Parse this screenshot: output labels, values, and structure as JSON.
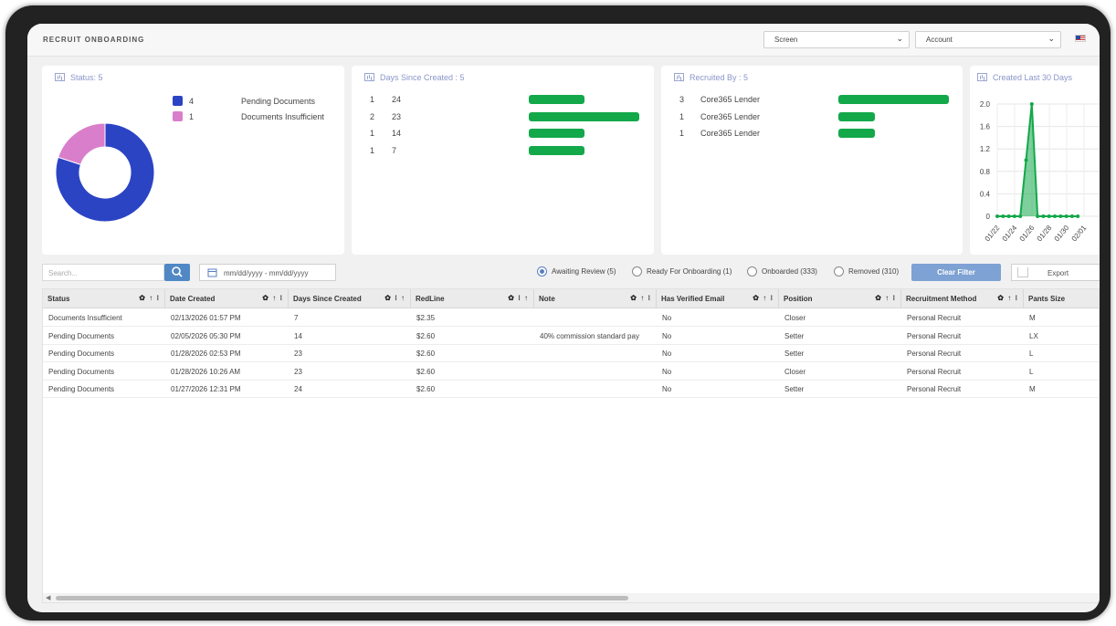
{
  "header": {
    "title": "RECRUIT ONBOARDING",
    "screen_select": "Screen",
    "account_select": "Account"
  },
  "status_card": {
    "title": "Status: 5",
    "legend": [
      {
        "count": "4",
        "label": "Pending Documents",
        "color": "#2b44c4"
      },
      {
        "count": "1",
        "label": "Documents Insufficient",
        "color": "#d97ecb"
      }
    ],
    "donut_values": [
      4,
      1
    ]
  },
  "days_card": {
    "title": "Days Since Created : 5",
    "rows": [
      {
        "count": "1",
        "label": "24",
        "value": 1
      },
      {
        "count": "2",
        "label": "23",
        "value": 2
      },
      {
        "count": "1",
        "label": "14",
        "value": 1
      },
      {
        "count": "1",
        "label": "7",
        "value": 1
      }
    ]
  },
  "recruited_card": {
    "title": "Recruited By : 5",
    "rows": [
      {
        "count": "3",
        "label": "Core365 Lender",
        "value": 3
      },
      {
        "count": "1",
        "label": "Core365 Lender",
        "value": 1
      },
      {
        "count": "1",
        "label": "Core365 Lender",
        "value": 1
      }
    ]
  },
  "created_card": {
    "title": "Created Last 30 Days"
  },
  "chart_data": {
    "type": "area",
    "title": "Created Last 30 Days",
    "y_ticks": [
      "2.0",
      "1.6",
      "1.2",
      "0.8",
      "0.4",
      "0"
    ],
    "ylim": [
      0,
      2
    ],
    "x_labels": [
      "01/22",
      "01/24",
      "01/26",
      "01/28",
      "01/30",
      "02/01"
    ],
    "series": [
      {
        "values": [
          0,
          0,
          0,
          0,
          0,
          1,
          2,
          0,
          0,
          0,
          0,
          0,
          0,
          0,
          0
        ]
      }
    ],
    "color": "#13a84a"
  },
  "filters": {
    "search_placeholder": "Search...",
    "date_placeholder": "mm/dd/yyyy - mm/dd/yyyy",
    "radios": [
      {
        "label": "Awaiting Review (5)",
        "checked": true
      },
      {
        "label": "Ready For Onboarding (1)",
        "checked": false
      },
      {
        "label": "Onboarded (333)",
        "checked": false
      },
      {
        "label": "Removed (310)",
        "checked": false
      }
    ],
    "clear_label": "Clear Filter",
    "export_label": "Export"
  },
  "table": {
    "columns": [
      "Status",
      "Date Created",
      "Days Since Created",
      "RedLine",
      "Note",
      "Has Verified Email",
      "Position",
      "Recruitment Method",
      "Pants Size"
    ],
    "column_tools": [
      "✿ ↑ ⁝",
      "✿ ↑ ⁝",
      "✿ ⁝ ↑",
      "✿ ⁝ ↑",
      "✿ ↑ ⁝",
      "✿ ↑ ⁝",
      "✿ ↑ ⁝",
      "✿ ↑ ⁝",
      ""
    ],
    "rows": [
      [
        "Documents Insufficient",
        "02/13/2026 01:57 PM",
        "7",
        "$2.35",
        "",
        "No",
        "Closer",
        "Personal Recruit",
        "M"
      ],
      [
        "Pending Documents",
        "02/05/2026 05:30 PM",
        "14",
        "$2.60",
        "40% commission standard pay",
        "No",
        "Setter",
        "Personal Recruit",
        "LX"
      ],
      [
        "Pending Documents",
        "01/28/2026 02:53 PM",
        "23",
        "$2.60",
        "",
        "No",
        "Setter",
        "Personal Recruit",
        "L"
      ],
      [
        "Pending Documents",
        "01/28/2026 10:26 AM",
        "23",
        "$2.60",
        "",
        "No",
        "Closer",
        "Personal Recruit",
        "L"
      ],
      [
        "Pending Documents",
        "01/27/2026 12:31 PM",
        "24",
        "$2.60",
        "",
        "No",
        "Setter",
        "Personal Recruit",
        "M"
      ]
    ]
  }
}
